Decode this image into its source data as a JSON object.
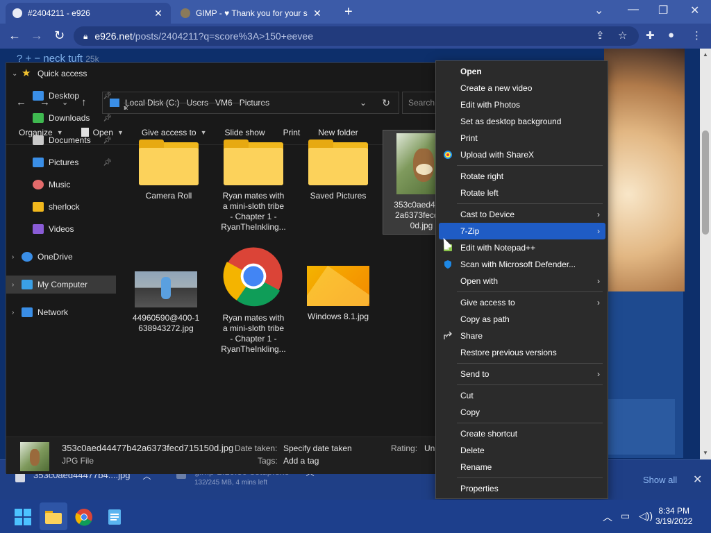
{
  "browser": {
    "tabs": [
      {
        "title": "#2404211 - e926",
        "active": true
      },
      {
        "title": "GIMP - ♥ Thank you for your s",
        "active": false
      }
    ],
    "url_host": "e926.net",
    "url_path": "/posts/2404211?q=score%3A>150+eevee"
  },
  "page": {
    "tag_prefix": "? + −",
    "tag_name": "neck tuft",
    "tag_count": "25k"
  },
  "downloads": [
    {
      "name": "353c0aed44477b4....jpg",
      "sub": ""
    },
    {
      "name": "gimp-2.10.30-setup.exe",
      "sub": "132/245 MB, 4 mins left"
    }
  ],
  "shelf": {
    "show_all": "Show all"
  },
  "explorer": {
    "breadcrumb": [
      "Local Disk (C:)",
      "Users",
      "VM6",
      "Pictures"
    ],
    "search_placeholder": "Search",
    "commands": [
      "Organize",
      "Open",
      "Give access to",
      "Slide show",
      "Print",
      "New folder"
    ],
    "nav": [
      {
        "label": "Quick access",
        "icon": "star-icon",
        "color": "#f2c230",
        "level": 0,
        "chev": "⌄",
        "pinned": false
      },
      {
        "label": "Desktop",
        "icon": "desktop-icon",
        "color": "#3a8ee6",
        "level": 1,
        "pinned": true
      },
      {
        "label": "Downloads",
        "icon": "download-icon",
        "color": "#3fb950",
        "level": 1,
        "pinned": true
      },
      {
        "label": "Documents",
        "icon": "document-icon",
        "color": "#c9c9c9",
        "level": 1,
        "pinned": true
      },
      {
        "label": "Pictures",
        "icon": "pictures-icon",
        "color": "#3a8ee6",
        "level": 1,
        "pinned": true
      },
      {
        "label": "Music",
        "icon": "music-icon",
        "color": "#e36b6b",
        "level": 1,
        "pinned": false
      },
      {
        "label": "sherlock",
        "icon": "folder-icon",
        "color": "#f1b81d",
        "level": 1,
        "pinned": false
      },
      {
        "label": "Videos",
        "icon": "videos-icon",
        "color": "#8a5cd6",
        "level": 1,
        "pinned": false
      },
      {
        "label": "OneDrive",
        "icon": "cloud-icon",
        "color": "#3a8ee6",
        "level": 0,
        "chev": "›",
        "pinned": false
      },
      {
        "label": "My Computer",
        "icon": "computer-icon",
        "color": "#3aa0e6",
        "level": 0,
        "chev": "›",
        "pinned": false,
        "selected": true
      },
      {
        "label": "Network",
        "icon": "network-icon",
        "color": "#3a8ee6",
        "level": 0,
        "chev": "›",
        "pinned": false
      }
    ],
    "files": [
      {
        "kind": "folder",
        "lines": [
          "Camera Roll"
        ]
      },
      {
        "kind": "folder",
        "lines": [
          "Ryan mates with",
          "a mini-sloth tribe",
          "- Chapter 1 -",
          "RyanTheInkling..."
        ]
      },
      {
        "kind": "folder",
        "lines": [
          "Saved Pictures"
        ]
      },
      {
        "kind": "eevee",
        "lines": [
          "353c0aed4447",
          "2a6373fecd71",
          "0d.jpg"
        ],
        "selected": true
      },
      {
        "kind": "scene",
        "lines": [
          "44960590@400-1",
          "638943272.jpg"
        ]
      },
      {
        "kind": "chrome",
        "lines": [
          "Ryan mates with",
          "a mini-sloth tribe",
          "- Chapter 1 -",
          "RyanTheInkling..."
        ]
      },
      {
        "kind": "win",
        "lines": [
          "Windows 8.1.jpg"
        ]
      }
    ],
    "status": {
      "filename": "353c0aed44477b42a6373fecd715150d.jpg",
      "filetype": "JPG File",
      "date_label": "Date taken:",
      "date_value": "Specify date taken",
      "tags_label": "Tags:",
      "tags_value": "Add a tag",
      "rating_label": "Rating:",
      "rating_value": "Unr"
    }
  },
  "context_menu": [
    {
      "label": "Open",
      "bold": true
    },
    {
      "label": "Create a new video"
    },
    {
      "label": "Edit with Photos"
    },
    {
      "label": "Set as desktop background"
    },
    {
      "label": "Print"
    },
    {
      "label": "Upload with ShareX",
      "icon": "sharex-icon"
    },
    {
      "sep": true
    },
    {
      "label": "Rotate right"
    },
    {
      "label": "Rotate left"
    },
    {
      "sep": true
    },
    {
      "label": "Cast to Device",
      "submenu": true
    },
    {
      "label": "7-Zip",
      "submenu": true,
      "highlight": true
    },
    {
      "label": "Edit with Notepad++",
      "icon": "notepadpp-icon"
    },
    {
      "label": "Scan with Microsoft Defender...",
      "icon": "defender-icon"
    },
    {
      "label": "Open with",
      "submenu": true
    },
    {
      "sep": true
    },
    {
      "label": "Give access to",
      "submenu": true
    },
    {
      "label": "Copy as path"
    },
    {
      "label": "Share",
      "icon": "share-icon"
    },
    {
      "label": "Restore previous versions"
    },
    {
      "sep": true
    },
    {
      "label": "Send to",
      "submenu": true
    },
    {
      "sep": true
    },
    {
      "label": "Cut"
    },
    {
      "label": "Copy"
    },
    {
      "sep": true
    },
    {
      "label": "Create shortcut"
    },
    {
      "label": "Delete"
    },
    {
      "label": "Rename"
    },
    {
      "sep": true
    },
    {
      "label": "Properties"
    }
  ],
  "taskbar": {
    "time": "8:34 PM",
    "date": "3/19/2022"
  },
  "colors": {
    "highlight": "#1f5cc5",
    "browser_frame": "#2f4b96",
    "folder": "#fcd25b"
  }
}
